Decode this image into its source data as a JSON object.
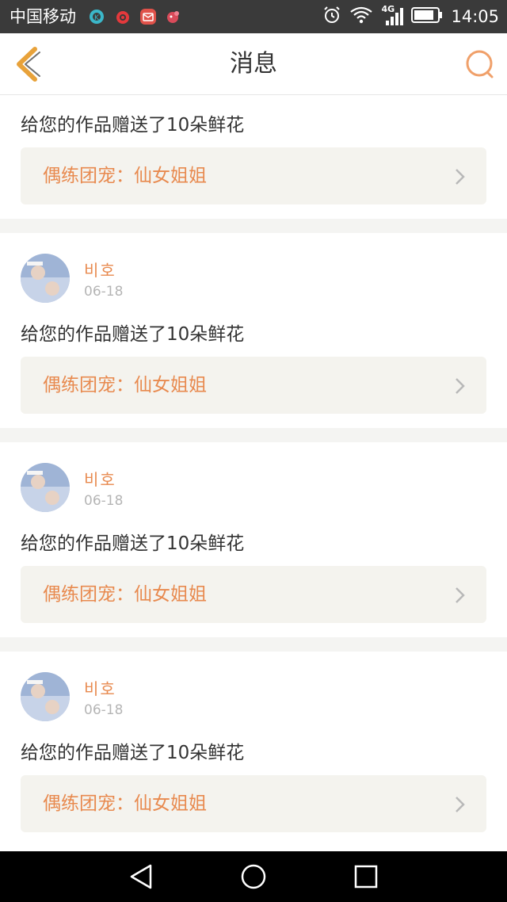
{
  "status_bar": {
    "carrier": "中国移动",
    "network": "4G",
    "time": "14:05",
    "icons": [
      "app-k-icon",
      "weibo-icon",
      "mail-app-icon",
      "game-app-icon",
      "alarm-icon",
      "wifi-icon",
      "signal-icon",
      "battery-icon"
    ]
  },
  "header": {
    "title": "消息",
    "accent_color": "#e8a23a",
    "icons": [
      "back-icon",
      "search-icon"
    ]
  },
  "partial_card": {
    "message": "给您的作品赠送了10朵鲜花",
    "work_title": "偶练团宠：仙女姐姐"
  },
  "messages": [
    {
      "username": "비호",
      "date": "06-18",
      "message": "给您的作品赠送了10朵鲜花",
      "work_title": "偶练团宠：仙女姐姐"
    },
    {
      "username": "비호",
      "date": "06-18",
      "message": "给您的作品赠送了10朵鲜花",
      "work_title": "偶练团宠：仙女姐姐"
    },
    {
      "username": "비호",
      "date": "06-18",
      "message": "给您的作品赠送了10朵鲜花",
      "work_title": "偶练团宠：仙女姐姐"
    }
  ],
  "colors": {
    "username": "#e88a4f",
    "work_title": "#e88a4f",
    "work_bg": "#f4f3ee",
    "page_bg": "#f4f4f2"
  },
  "system_nav": {
    "icons": [
      "nav-back-icon",
      "nav-home-icon",
      "nav-recents-icon"
    ]
  }
}
